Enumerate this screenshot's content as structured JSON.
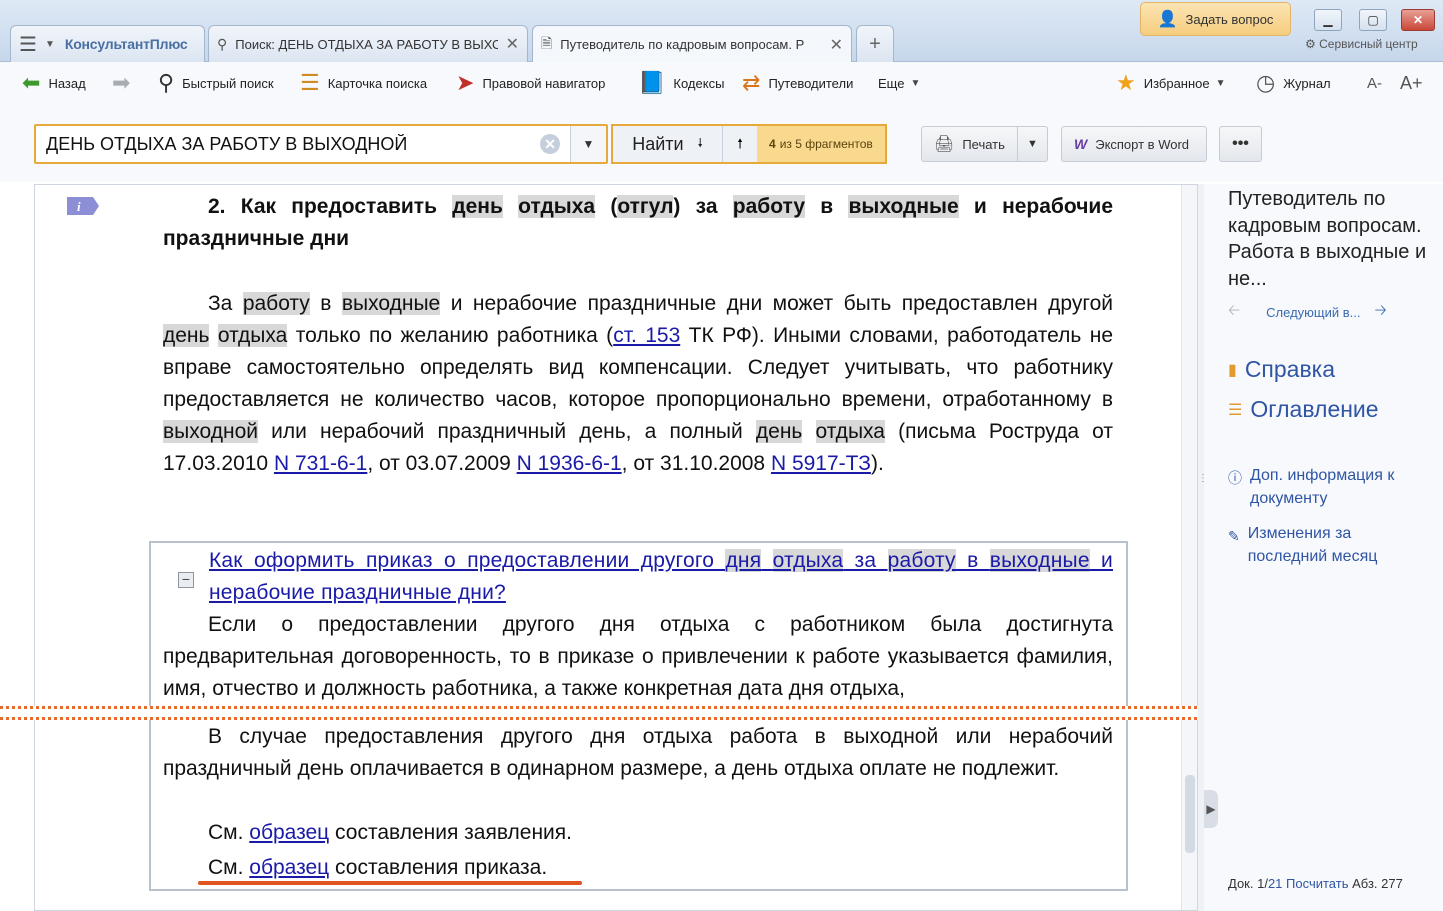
{
  "tabs": {
    "menu_brand": "КонсультантПлюс",
    "search_tab": "Поиск: ДЕНЬ ОТДЫХА ЗА РАБОТУ В ВЫХО",
    "guide_tab": "Путеводитель по кадровым вопросам. Р",
    "new_tab": "+"
  },
  "window": {
    "ask_question": "Задать вопрос",
    "service_center": "Сервисный центр"
  },
  "toolbar": {
    "back": "Назад",
    "quick_search": "Быстрый поиск",
    "search_card": "Карточка поиска",
    "legal_navigator": "Правовой навигатор",
    "codes": "Кодексы",
    "guides": "Путеводители",
    "more": "Еще",
    "favorites": "Избранное",
    "journal": "Журнал",
    "font_smaller": "А-",
    "font_larger": "А+"
  },
  "search": {
    "query": "ДЕНЬ ОТДЫХА ЗА РАБОТУ В ВЫХОДНОЙ",
    "find_label": "Найти",
    "fragment_current": "4",
    "fragment_rest": "из 5 фрагментов",
    "print": "Печать",
    "export_word": "Экспорт в Word",
    "more": "•••"
  },
  "document": {
    "heading": {
      "t0": "2. Как предоставить ",
      "h0": "день",
      "t1": " ",
      "h1": "отдыха",
      "t2": " (",
      "h2": "отгул",
      "t3": ") за ",
      "h3": "работу",
      "t4": " в ",
      "h4": "выходные",
      "t5": " и нерабочие праздничные дни"
    },
    "p1": {
      "t0": "За ",
      "h0": "работу",
      "t1": " в ",
      "h1": "выходные",
      "t2": " и нерабочие праздничные дни может быть предоставлен другой ",
      "h2": "день",
      "t3": " ",
      "h3": "отдыха",
      "t4": " только по желанию работника (",
      "l0": "ст. 153",
      "t5": " ТК РФ). Иными словами, работодатель не вправе самостоятельно определять вид компенсации. Следует учитывать, что работнику предоставляется не количество часов, которое пропорционально времени, отработанному в ",
      "h4": "выходной",
      "t6": " или нерабочий праздничный день, а полный ",
      "h5": "день",
      "t7": " ",
      "h6": "отдыха",
      "t8": " (письма Роструда от 17.03.2010 ",
      "l1": "N 731-6-1",
      "t9": ", от 03.07.2009 ",
      "l2": "N 1936-6-1",
      "t10": ", от 31.10.2008 ",
      "l3": "N 5917-ТЗ",
      "t11": ")."
    },
    "box": {
      "title": {
        "t0": "Как оформить приказ о предоставлении другого ",
        "h0": "дня",
        "t1": " ",
        "h1": "отдыха",
        "t2": " за ",
        "h2": "работу",
        "t3": " в ",
        "h3": "выходные",
        "t4": " и нерабочие праздничные дни?"
      },
      "p1": "Если о предоставлении другого дня отдыха с работником была достигнута предварительная договоренность, то в приказе о привлечении к работе указывается фамилия, имя, отчество и должность работника, а также конкретная дата дня отдыха,",
      "p2": "В случае предоставления другого дня отдыха работа в выходной или нерабочий праздничный день оплачивается в одинарном размере, а день отдыха оплате не подлежит.",
      "p3": {
        "t0": "См. ",
        "l0": "образец",
        "t1": " составления заявления."
      },
      "p4": {
        "t0": "См. ",
        "l0": "образец",
        "t1": " составления приказа."
      }
    }
  },
  "panel": {
    "title": "Путеводитель по кадровым вопросам. Работа в выходные и не...",
    "next": "Следующий в...",
    "help": "Справка",
    "toc": "Оглавление",
    "doc_info": "Доп. информация к документу",
    "changes": "Изменения за последний месяц",
    "status_doc": "Док. 1/",
    "status_total": "21",
    "status_count": "Посчитать",
    "status_para": "Абз. 277"
  },
  "colors": {
    "search_border": "#e6a93a",
    "fragment_bg": "#f9d98d",
    "link": "#1a1aa8",
    "highlight": "#d8d8d8",
    "accent_orange": "#e0541f"
  }
}
